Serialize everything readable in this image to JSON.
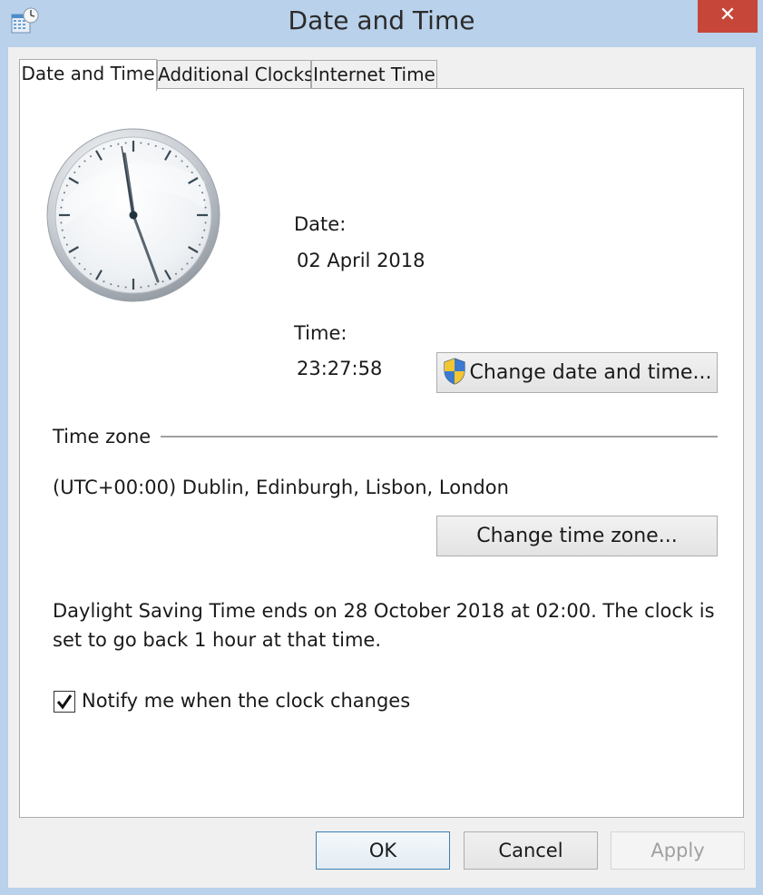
{
  "window": {
    "title": "Date and Time",
    "close_glyph": "✕"
  },
  "tabs": [
    {
      "label": "Date and Time",
      "active": true
    },
    {
      "label": "Additional Clocks",
      "active": false
    },
    {
      "label": "Internet Time",
      "active": false
    }
  ],
  "datetime": {
    "date_label": "Date:",
    "date_value": "02 April 2018",
    "time_label": "Time:",
    "time_value": "23:27:58",
    "change_button": "Change date and time..."
  },
  "timezone": {
    "heading": "Time zone",
    "value": "(UTC+00:00) Dublin, Edinburgh, Lisbon, London",
    "change_button": "Change time zone..."
  },
  "dst": {
    "line1": "Daylight Saving Time ends on 28 October 2018 at 02:00. The clock is",
    "line2": "set to go back 1 hour at that time."
  },
  "notify": {
    "label": "Notify me when the clock changes",
    "checked": true
  },
  "footer": {
    "ok": "OK",
    "cancel": "Cancel",
    "apply": "Apply"
  },
  "icons": {
    "app": "calendar-clock-icon",
    "shield": "uac-shield-icon",
    "close": "close-icon",
    "check": "checkmark-icon"
  },
  "colors": {
    "titlebar": "#b9d1ea",
    "close_button": "#c7463a",
    "panel": "#ffffff",
    "dialog_bg": "#f0f0f0"
  }
}
